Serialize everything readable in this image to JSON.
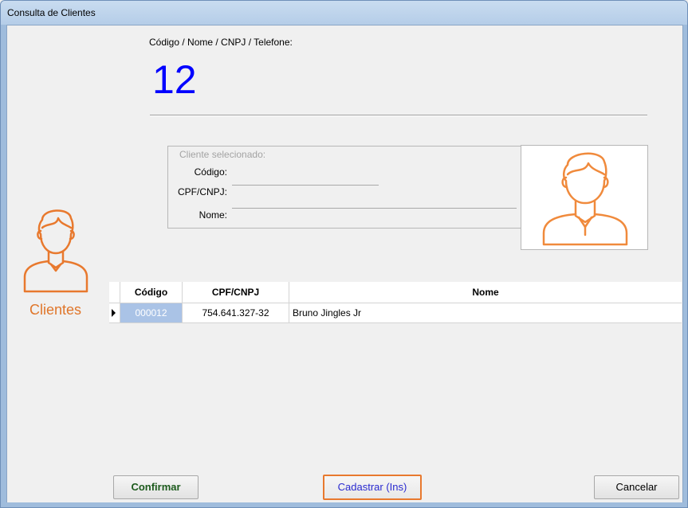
{
  "window": {
    "title": "Consulta de Clientes"
  },
  "search": {
    "label": "Código / Nome / CNPJ / Telefone:",
    "value": "12"
  },
  "selected_client": {
    "title": "Cliente selecionado:",
    "code_label": "Código:",
    "code_value": "",
    "cpf_label": "CPF/CNPJ:",
    "cpf_value": "",
    "name_label": "Nome:",
    "name_value": ""
  },
  "sidebar": {
    "label": "Clientes"
  },
  "grid": {
    "columns": [
      "Código",
      "CPF/CNPJ",
      "Nome"
    ],
    "rows": [
      {
        "code": "000012",
        "cpf": "754.641.327-32",
        "name": "Bruno Jingles Jr",
        "selected": true
      }
    ]
  },
  "buttons": {
    "confirm": "Confirmar",
    "register": "Cadastrar (Ins)",
    "cancel": "Cancelar"
  },
  "colors": {
    "accent_orange": "#e8792e",
    "search_value_blue": "#0000ff",
    "selection_blue": "#aac3e6"
  },
  "icons": {
    "photo_placeholder": "person-avatar-icon",
    "sidebar_icon": "person-avatar-icon",
    "row_indicator": "row-pointer-icon"
  }
}
